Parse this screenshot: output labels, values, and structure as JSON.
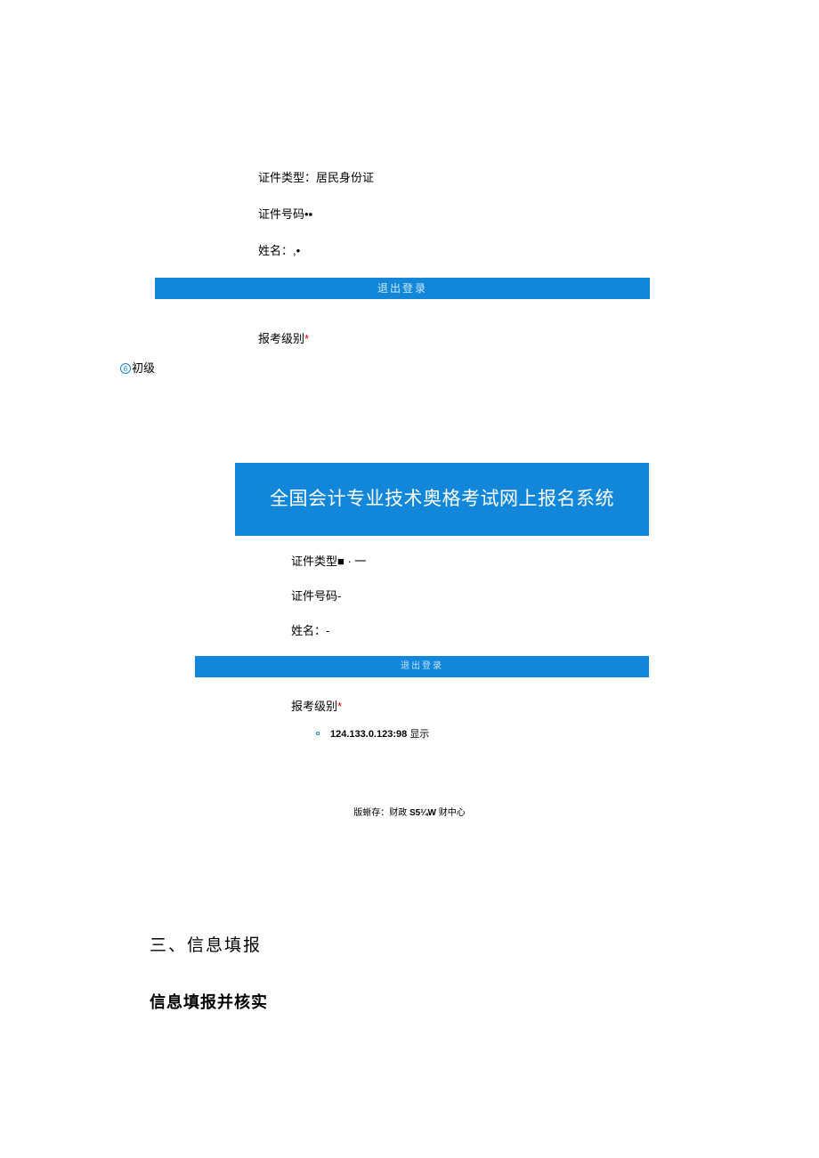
{
  "module1": {
    "idTypeLabel": "证件类型：",
    "idTypeValue": "居民身份证",
    "idNumberLabel": "证件号码•▪",
    "nameLabel": "姓名：",
    "nameValue": ",•",
    "logout": "退出登录",
    "levelLabel": "报考级别",
    "levelRequired": "*",
    "circleIcon": "6",
    "levelValue": "初级"
  },
  "module2": {
    "banner": "全国会计专业技术奥格考试网上报名系统",
    "idTypeLabel": "证件类型■ · 一",
    "idNumberLabel": "证件号码-",
    "nameLabel": "姓名：",
    "nameValue": "-",
    "logout": "退出登录",
    "levelLabel": "报考级别",
    "levelRequired": "*",
    "ipBold": "124.133.0.123:98 ",
    "ipText": "显示",
    "footerLabel": "版蜥存：财政 ",
    "footerBold": "S5¼W",
    "footerTail": " 财中心"
  },
  "headings": {
    "h1": "三、信息填报",
    "h2": "信息填报并核实"
  }
}
